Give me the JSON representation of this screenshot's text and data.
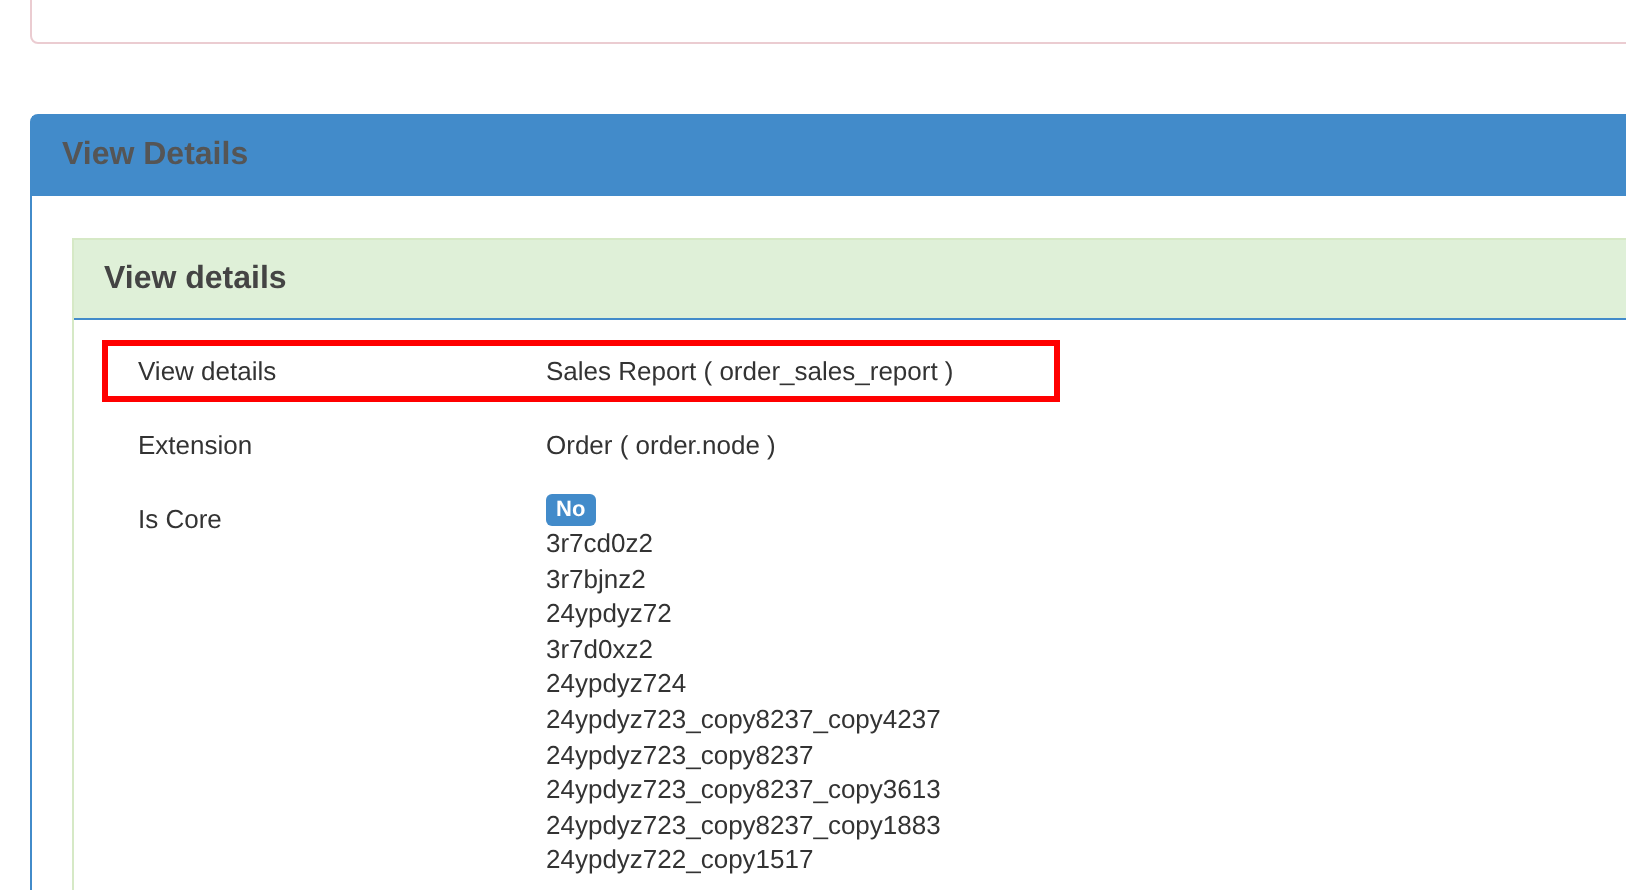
{
  "outer_panel": {
    "title": "View Details"
  },
  "inner_panel": {
    "title": "View details"
  },
  "rows": [
    {
      "kind": "text",
      "label": "View details",
      "value": "Sales Report ( order_sales_report )",
      "highlighted": true
    },
    {
      "kind": "text",
      "label": "Extension",
      "value": "Order ( order.node )",
      "highlighted": false
    },
    {
      "kind": "badge_list",
      "label": "Is Core",
      "badge": "No",
      "items": [
        "3r7cd0z2",
        "3r7bjnz2",
        "24ypdyz72",
        "3r7d0xz2",
        "24ypdyz724",
        "24ypdyz723_copy8237_copy4237",
        "24ypdyz723_copy8237",
        "24ypdyz723_copy8237_copy3613",
        "24ypdyz723_copy8237_copy1883",
        "24ypdyz722_copy1517"
      ],
      "highlighted": false
    }
  ]
}
